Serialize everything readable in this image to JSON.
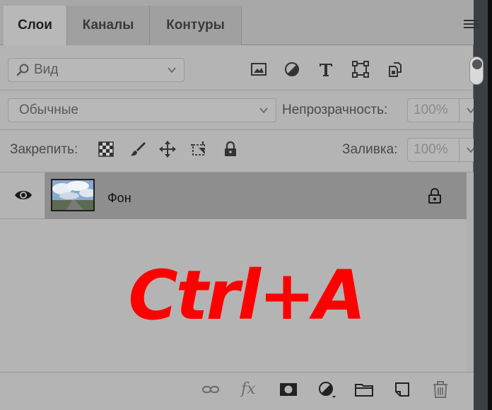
{
  "tabs": [
    {
      "label": "Слои",
      "active": true
    },
    {
      "label": "Каналы",
      "active": false
    },
    {
      "label": "Контуры",
      "active": false
    }
  ],
  "filter": {
    "label": "Вид",
    "icon": "search-icon"
  },
  "filter_icons": [
    "image-filter-icon",
    "adjustment-filter-icon",
    "type-filter-icon",
    "shape-filter-icon",
    "smart-object-filter-icon"
  ],
  "blend_mode": {
    "value": "Обычные"
  },
  "opacity": {
    "label": "Непрозрачность:",
    "value": "100%"
  },
  "lock": {
    "label": "Закрепить:",
    "icons": [
      "lock-transparent-icon",
      "lock-image-icon",
      "lock-position-icon",
      "lock-artboard-icon",
      "lock-all-icon"
    ]
  },
  "fill": {
    "label": "Заливка:",
    "value": "100%"
  },
  "layers": [
    {
      "name": "Фон",
      "visible": true,
      "locked": true
    }
  ],
  "overlay": {
    "text": "Ctrl+A",
    "color": "#ff0000"
  },
  "bottom_icons": [
    "link-icon",
    "fx-icon",
    "mask-icon",
    "adjustment-layer-icon",
    "group-folder-icon",
    "new-layer-icon",
    "trash-icon"
  ],
  "fx_label": "fx"
}
